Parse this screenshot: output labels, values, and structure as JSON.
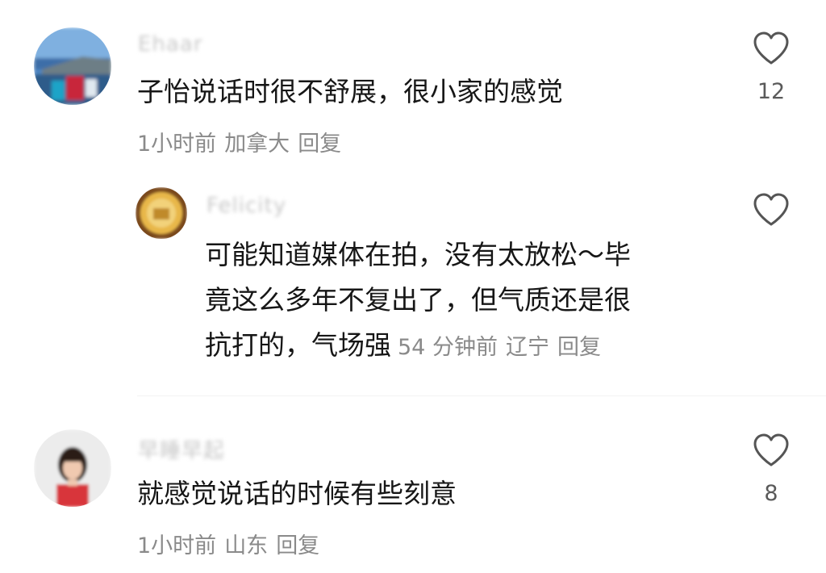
{
  "comments": [
    {
      "username": "Ehaar",
      "text": "子怡说话时很不舒展，很小家的感觉",
      "time": "1小时前",
      "location": "加拿大",
      "reply_label": "回复",
      "likes": "12",
      "avatar_icon": "landscape-avatar"
    },
    {
      "username": "Felicity",
      "lines": [
        "可能知道媒体在拍，没有太放松～毕",
        "竟这么多年不复出了，但气质还是很",
        "抗打的，气场强"
      ],
      "time": "54 分钟前",
      "location": "辽宁",
      "reply_label": "回复",
      "likes": "",
      "avatar_icon": "gold-circle-avatar"
    },
    {
      "username": "早睡早起",
      "text": "就感觉说话的时候有些刻意",
      "time": "1小时前",
      "location": "山东",
      "reply_label": "回复",
      "likes": "8",
      "avatar_icon": "girl-avatar"
    }
  ],
  "colors": {
    "text": "#161616",
    "meta": "#8a8a8a",
    "heart_outline": "#555555"
  },
  "icons": {
    "like": "heart-outline-icon"
  }
}
